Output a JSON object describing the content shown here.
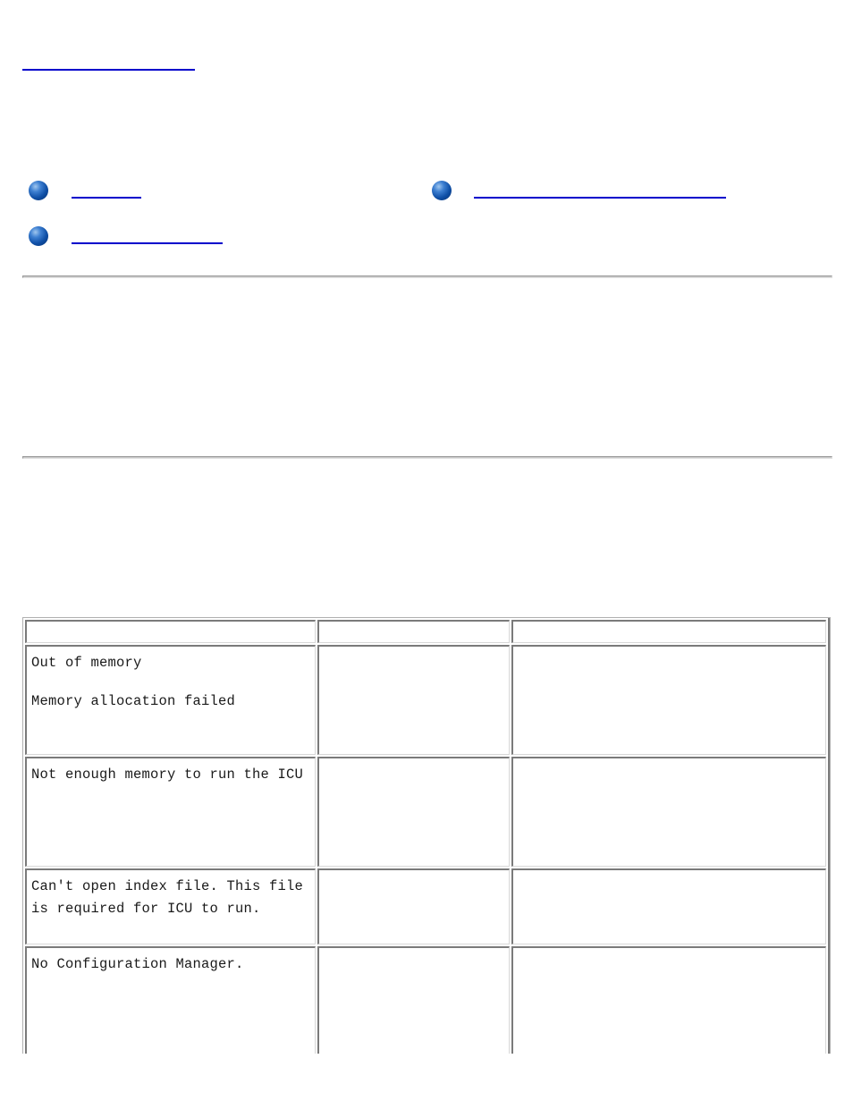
{
  "page": {
    "back_link": {
      "label": "",
      "color": "#0000cc"
    },
    "nav_links": [
      {
        "label": "",
        "icon": "globe-bullet-icon"
      },
      {
        "label": "",
        "icon": "globe-bullet-icon"
      },
      {
        "label": "",
        "icon": "globe-bullet-icon"
      }
    ],
    "link_color": "#0000cc"
  },
  "error_table": {
    "headers": [
      "",
      "",
      ""
    ],
    "rows": [
      {
        "message_lines": [
          "Out of memory",
          "Memory allocation failed"
        ],
        "cause": "",
        "action": ""
      },
      {
        "message_lines": [
          "Not enough memory to run the ICU"
        ],
        "cause": "",
        "action": ""
      },
      {
        "message_lines": [
          "Can't open index file. This file is required for ICU to run."
        ],
        "cause": "",
        "action": ""
      },
      {
        "message_lines": [
          "No Configuration Manager."
        ],
        "cause": "",
        "action": ""
      }
    ]
  }
}
